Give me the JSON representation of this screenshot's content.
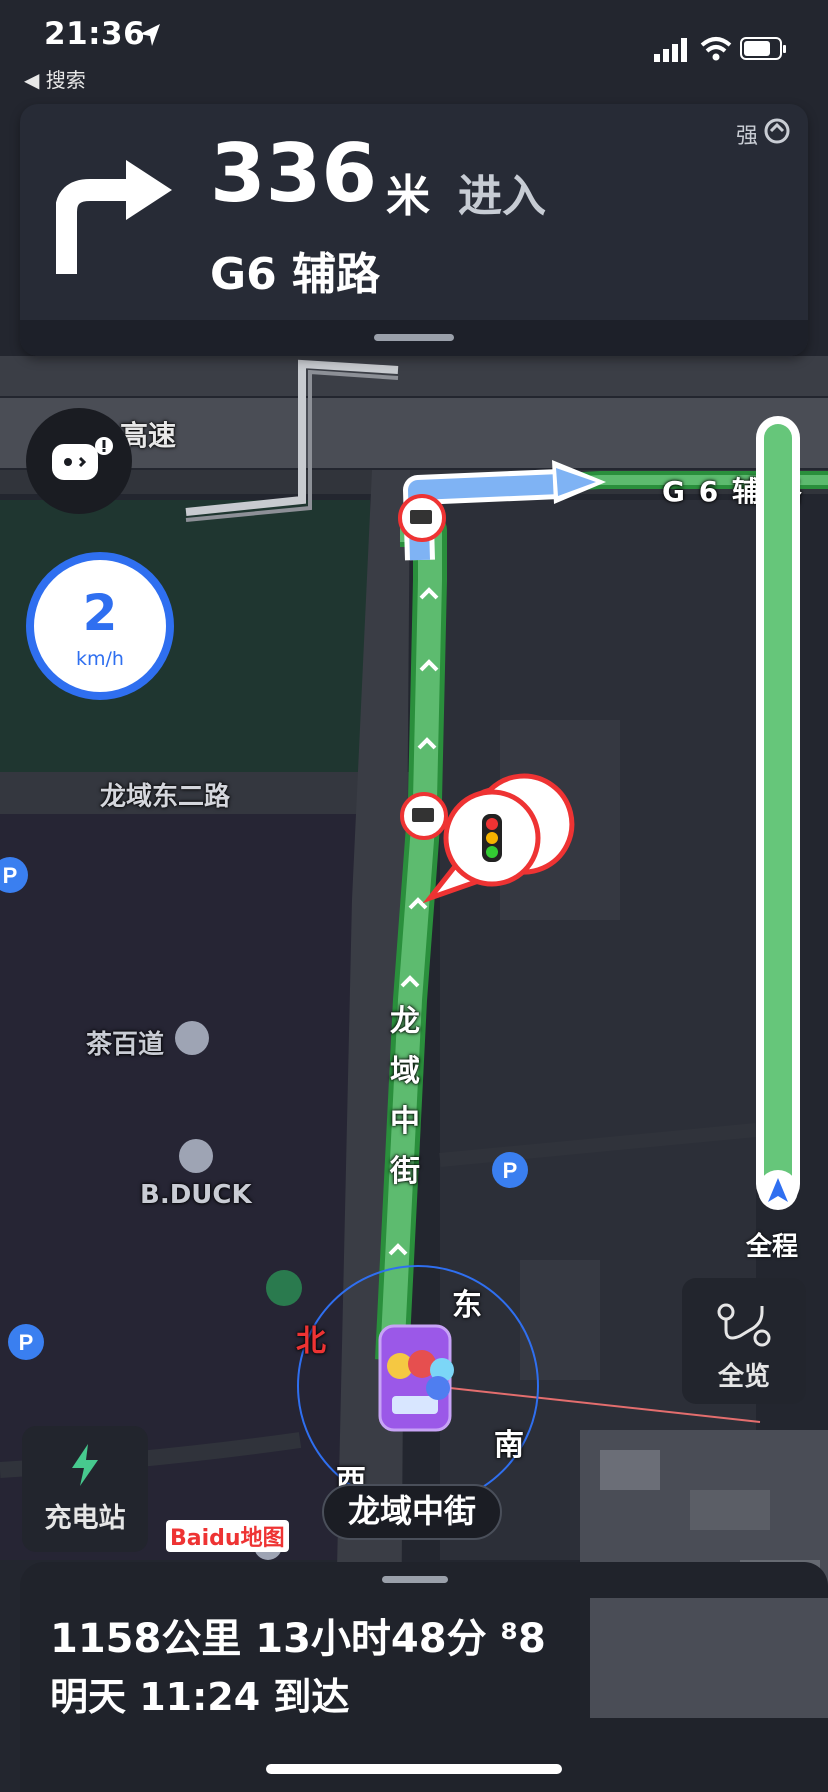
{
  "status_bar": {
    "time": "21:36",
    "back_label": "◀ 搜索"
  },
  "banner": {
    "distance": "336",
    "unit": "米",
    "action": "进入",
    "road": "G6 辅路",
    "signal": "强"
  },
  "speed": {
    "value": "2",
    "unit": "km/h"
  },
  "map": {
    "label_highway": "高速",
    "label_g6_branch": "G 6 辅 路",
    "label_road_east2": "龙域东二路",
    "label_tea": "茶百道",
    "label_bduck": "B.DUCK",
    "label_street_vertical": [
      "龙",
      "域",
      "中",
      "街"
    ],
    "compass_north": "北",
    "compass_east": "东",
    "compass_south": "南",
    "compass_west": "西",
    "logo": "Baidu地图"
  },
  "sidebar_right": {
    "progress_label": "全程",
    "overview_label": "全览"
  },
  "charge_station": {
    "label": "充电站"
  },
  "current_road": "龙域中街",
  "trip": {
    "summary": "1158公里 13小时48分 ⁸8",
    "arrival": "明天 11:24 到达"
  },
  "colors": {
    "route_green": "#5dbb6f",
    "speed_blue": "#2f6ff0",
    "panel_dark": "#272b36"
  }
}
